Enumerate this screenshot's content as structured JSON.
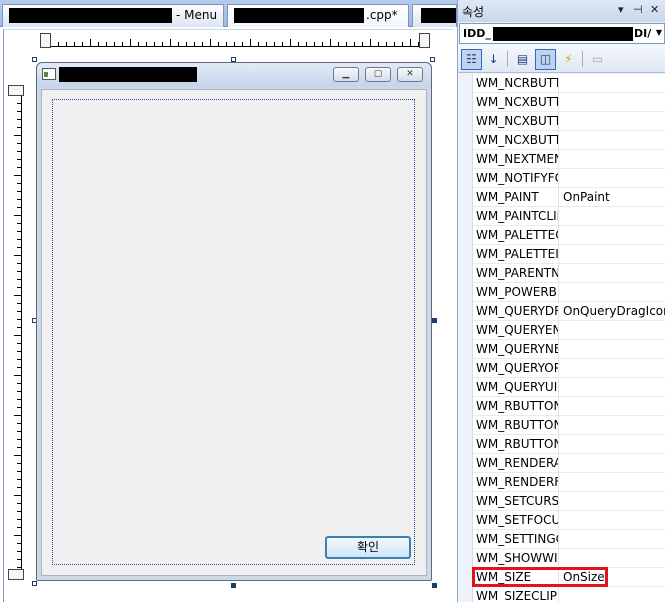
{
  "tabs": [
    {
      "label": "- Menu"
    },
    {
      "label": ".cpp*"
    },
    {
      "label": ""
    }
  ],
  "dialog": {
    "ok_button": "확인",
    "minimize_glyph": "▁",
    "maximize_glyph": "▢",
    "close_glyph": "✕"
  },
  "properties": {
    "panel_title": "속성",
    "object_prefix": "IDD_",
    "object_suffix": "DI/",
    "header_icons": [
      "dropdown-arrow-icon",
      "pin-icon",
      "close-icon"
    ],
    "toolbar_icons": [
      "categorized-icon",
      "alphabetical-icon",
      "properties-icon",
      "messages-icon",
      "events-icon",
      "overrides-icon"
    ],
    "rows": [
      {
        "name": "WM_NCRBUTTON",
        "value": ""
      },
      {
        "name": "WM_NCXBUTTON",
        "value": ""
      },
      {
        "name": "WM_NCXBUTTON",
        "value": ""
      },
      {
        "name": "WM_NCXBUTTON",
        "value": ""
      },
      {
        "name": "WM_NEXTMENU",
        "value": ""
      },
      {
        "name": "WM_NOTIFYFORMAT",
        "value": ""
      },
      {
        "name": "WM_PAINT",
        "value": "OnPaint"
      },
      {
        "name": "WM_PAINTCLIPBOARD",
        "value": ""
      },
      {
        "name": "WM_PALETTECHANGED",
        "value": ""
      },
      {
        "name": "WM_PALETTEISCHANGING",
        "value": ""
      },
      {
        "name": "WM_PARENTNOTIFY",
        "value": ""
      },
      {
        "name": "WM_POWERBROADCAST",
        "value": ""
      },
      {
        "name": "WM_QUERYDRAGICON",
        "value": "OnQueryDragIcon"
      },
      {
        "name": "WM_QUERYENDSESSION",
        "value": ""
      },
      {
        "name": "WM_QUERYNEWPALETTE",
        "value": ""
      },
      {
        "name": "WM_QUERYOPEN",
        "value": ""
      },
      {
        "name": "WM_QUERYUISTATE",
        "value": ""
      },
      {
        "name": "WM_RBUTTONDBLCLK",
        "value": ""
      },
      {
        "name": "WM_RBUTTONDOWN",
        "value": ""
      },
      {
        "name": "WM_RBUTTONUP",
        "value": ""
      },
      {
        "name": "WM_RENDERALLFORMATS",
        "value": ""
      },
      {
        "name": "WM_RENDERFORMAT",
        "value": ""
      },
      {
        "name": "WM_SETCURSOR",
        "value": ""
      },
      {
        "name": "WM_SETFOCUS",
        "value": ""
      },
      {
        "name": "WM_SETTINGCHANGE",
        "value": ""
      },
      {
        "name": "WM_SHOWWINDOW",
        "value": ""
      },
      {
        "name": "WM_SIZE",
        "value": "OnSize"
      },
      {
        "name": "WM_SIZECLIPBOARD",
        "value": ""
      }
    ],
    "highlight_color": "#e0141e"
  }
}
